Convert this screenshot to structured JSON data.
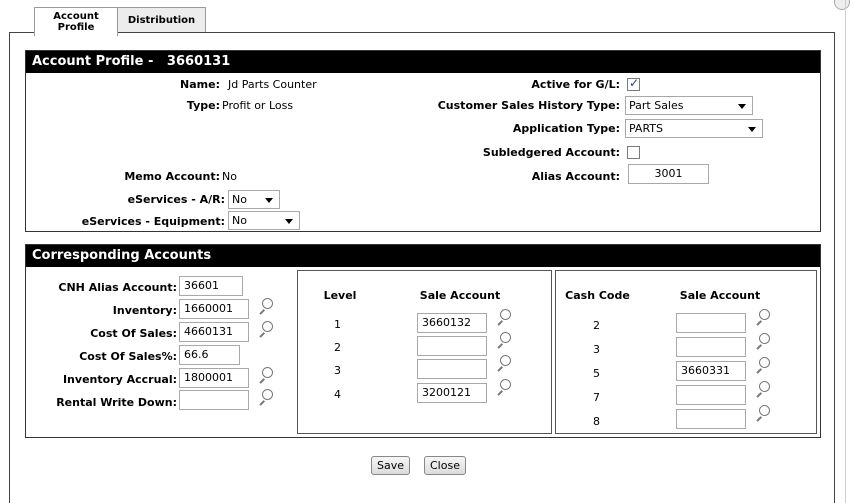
{
  "tabs": [
    {
      "label": "Account\nProfile"
    },
    {
      "label": "Distribution"
    }
  ],
  "profile": {
    "header": "Account Profile -   3660131",
    "name_label": "Name:",
    "name_value": "Jd Parts Counter",
    "type_label": "Type:",
    "type_value": "Profit or Loss",
    "active_label": "Active for G/L:",
    "active_checked": true,
    "csh_label": "Customer Sales History Type:",
    "csh_value": "Part Sales",
    "app_label": "Application Type:",
    "app_value": "PARTS",
    "subledger_label": "Subledgered Account:",
    "subledger_checked": false,
    "memo_label": "Memo Account:",
    "memo_value": "No",
    "alias_label": "Alias Account:",
    "alias_value": "3001",
    "eservices_ar_label": "eServices - A/R:",
    "eservices_ar_value": "No",
    "eservices_eq_label": "eServices - Equipment:",
    "eservices_eq_value": "No"
  },
  "corresponding": {
    "header": "Corresponding Accounts",
    "left_fields": [
      {
        "label": "CNH Alias Account:",
        "value": "36601",
        "lookup": false
      },
      {
        "label": "Inventory:",
        "value": "1660001",
        "lookup": true
      },
      {
        "label": "Cost Of Sales:",
        "value": "4660131",
        "lookup": true
      },
      {
        "label": "Cost Of Sales%:",
        "value": "66.6",
        "lookup": false
      },
      {
        "label": "Inventory Accrual:",
        "value": "1800001",
        "lookup": true
      },
      {
        "label": "Rental Write Down:",
        "value": "",
        "lookup": true
      }
    ],
    "level_table": {
      "level_header": "Level",
      "sale_header": "Sale Account",
      "rows": [
        {
          "level": "1",
          "account": "3660132"
        },
        {
          "level": "2",
          "account": ""
        },
        {
          "level": "3",
          "account": ""
        },
        {
          "level": "4",
          "account": "3200121"
        }
      ]
    },
    "cash_table": {
      "code_header": "Cash Code",
      "sale_header": "Sale Account",
      "rows": [
        {
          "code": "2",
          "account": ""
        },
        {
          "code": "3",
          "account": ""
        },
        {
          "code": "5",
          "account": "3660331"
        },
        {
          "code": "7",
          "account": ""
        },
        {
          "code": "8",
          "account": ""
        }
      ]
    }
  },
  "buttons": {
    "save": "Save",
    "close": "Close"
  },
  "colors": {
    "header_bg": "#000000",
    "header_text": "#ffffff",
    "checkbox_check": "#1f3f9a"
  }
}
